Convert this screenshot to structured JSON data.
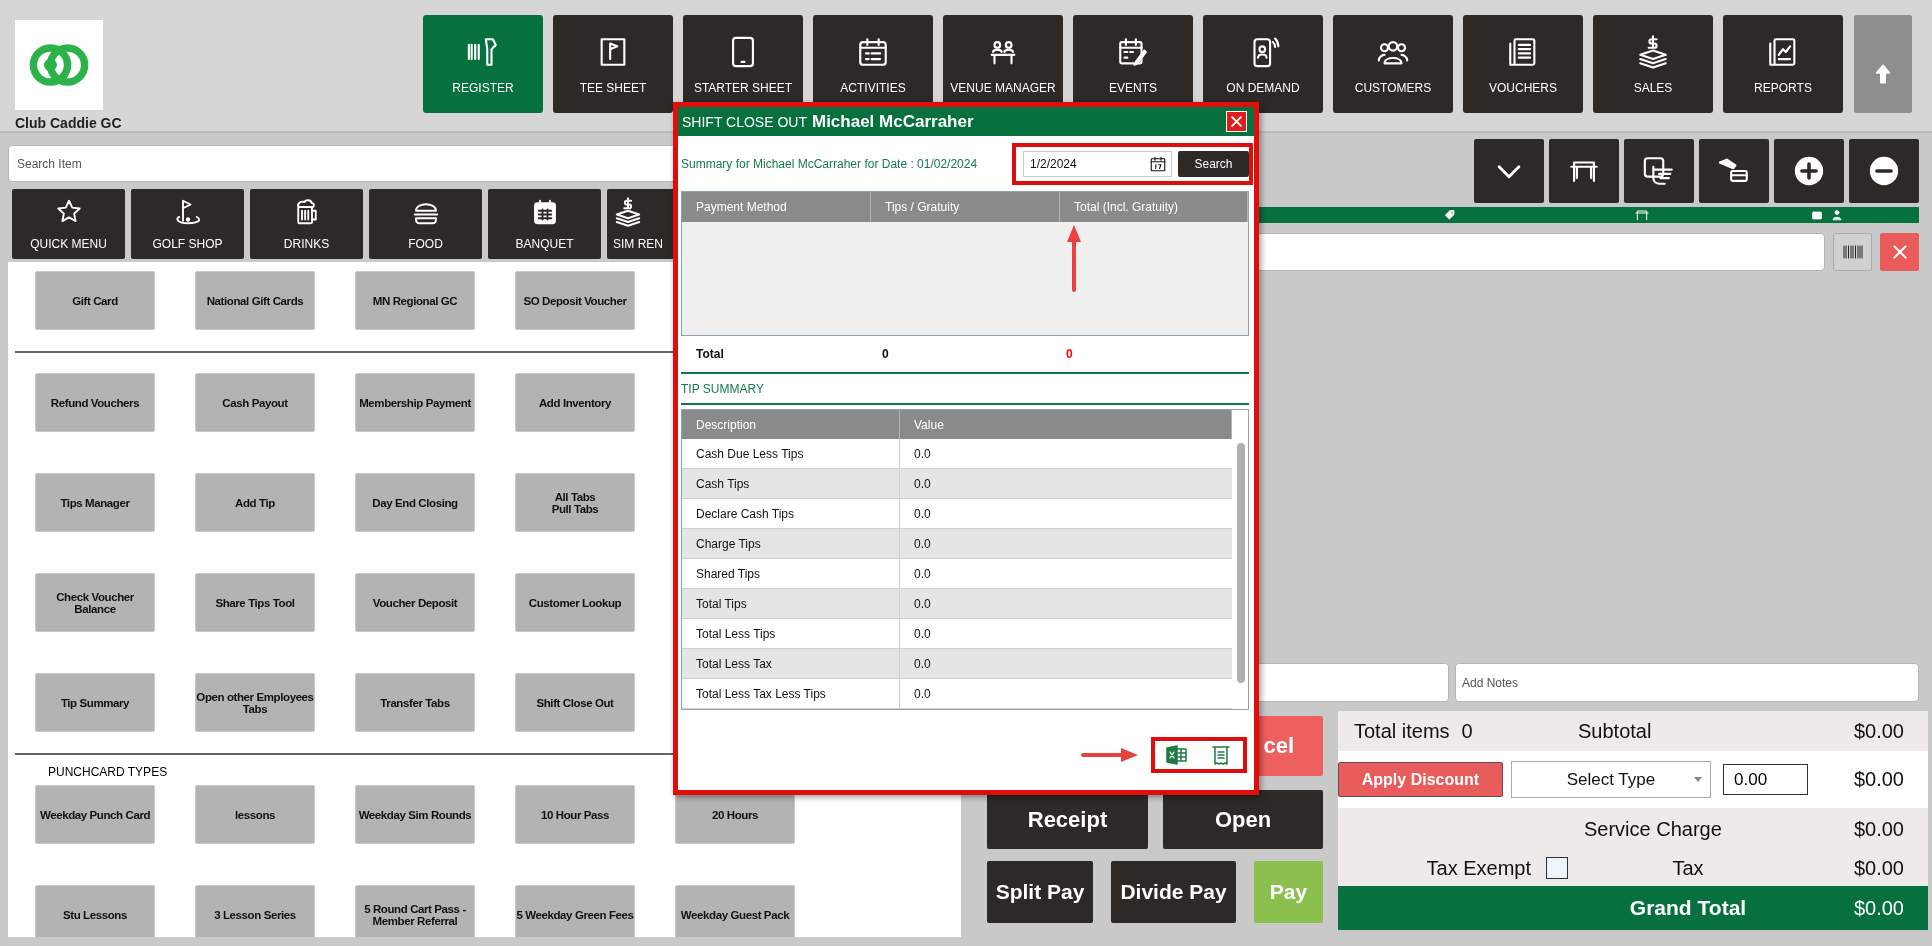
{
  "app": {
    "name": "Club Caddie GC"
  },
  "nav": [
    {
      "label": "REGISTER",
      "selected": true
    },
    {
      "label": "TEE SHEET",
      "selected": false
    },
    {
      "label": "STARTER SHEET",
      "selected": false
    },
    {
      "label": "ACTIVITIES",
      "selected": false
    },
    {
      "label": "VENUE MANAGER",
      "selected": false
    },
    {
      "label": "EVENTS",
      "selected": false
    },
    {
      "label": "ON DEMAND",
      "selected": false
    },
    {
      "label": "CUSTOMERS",
      "selected": false
    },
    {
      "label": "VOUCHERS",
      "selected": false
    },
    {
      "label": "SALES",
      "selected": false
    },
    {
      "label": "REPORTS",
      "selected": false
    }
  ],
  "search": {
    "placeholder": "Search Item"
  },
  "categories": [
    "QUICK MENU",
    "GOLF SHOP",
    "DRINKS",
    "FOOD",
    "BANQUET",
    "SIM REN"
  ],
  "item_sections": [
    {
      "rows": [
        [
          "Gift Card",
          "National Gift Cards",
          "MN Regional GC",
          "SO Deposit Voucher"
        ]
      ]
    },
    {
      "rows": [
        [
          "Refund Vouchers",
          "Cash Payout",
          "Membership Payment",
          "Add Inventory"
        ],
        [
          "Tips Manager",
          "Add Tip",
          "Day End Closing",
          "All Tabs\nPull Tabs"
        ],
        [
          "Check Voucher Balance",
          "Share Tips Tool",
          "Voucher Deposit",
          "Customer Lookup"
        ],
        [
          "Tip Summary",
          "Open other Employees Tabs",
          "Transfer Tabs",
          "Shift Close Out"
        ]
      ]
    },
    {
      "title": "PUNCHCARD TYPES",
      "rows": [
        [
          "Weekday Punch Card",
          "lessons",
          "Weekday Sim Rounds",
          "10 Hour Pass",
          "20 Hours"
        ],
        [
          "Stu Lessons",
          "3 Lesson Series",
          "5 Round Cart Pass - Member Referral",
          "5 Weekday Green Fees",
          "Weekday Guest Pack"
        ]
      ]
    }
  ],
  "order": {
    "notes_placeholder": "Add Notes",
    "buttons": [
      {
        "label": "cel",
        "kind": "cancel"
      },
      {
        "label": "Receipt",
        "kind": "dark"
      },
      {
        "label": "Open",
        "kind": "dark"
      },
      {
        "label": "Split Pay",
        "kind": "dark"
      },
      {
        "label": "Divide Pay",
        "kind": "dark"
      },
      {
        "label": "Pay",
        "kind": "pay"
      }
    ],
    "totals": {
      "items_label": "Total items",
      "items_count": "0",
      "subtotal_label": "Subtotal",
      "subtotal": "$0.00",
      "discount_button": "Apply Discount",
      "discount_type": "Select Type",
      "discount_value": "0.00",
      "discount_amount": "$0.00",
      "service_label": "Service Charge",
      "service": "$0.00",
      "tax_exempt_label": "Tax Exempt",
      "tax_exempt": false,
      "tax_label": "Tax",
      "tax": "$0.00",
      "grand_label": "Grand Total",
      "grand": "$0.00"
    }
  },
  "dialog": {
    "title": "SHIFT CLOSE OUT",
    "employee": "Michael McCarraher",
    "summary": "Summary for Michael McCarraher for Date : 01/02/2024",
    "date": "1/2/2024",
    "search_button": "Search",
    "payment_columns": [
      "Payment Method",
      "Tips / Gratuity",
      "Total (Incl. Gratuity)"
    ],
    "total_row": {
      "label": "Total",
      "tips": "0",
      "total": "0"
    },
    "tip_section": "TIP SUMMARY",
    "tip_columns": [
      "Description",
      "Value"
    ],
    "tip_rows": [
      {
        "description": "Cash Due Less Tips",
        "value": "0.0"
      },
      {
        "description": "Cash Tips",
        "value": "0.0"
      },
      {
        "description": "Declare Cash Tips",
        "value": "0.0"
      },
      {
        "description": "Charge Tips",
        "value": "0.0"
      },
      {
        "description": "Shared Tips",
        "value": "0.0"
      },
      {
        "description": "Total Tips",
        "value": "0.0"
      },
      {
        "description": "Total Less Tips",
        "value": "0.0"
      },
      {
        "description": "Total Less Tax",
        "value": "0.0"
      },
      {
        "description": "Total Less Tax Less Tips",
        "value": "0.0"
      }
    ]
  }
}
